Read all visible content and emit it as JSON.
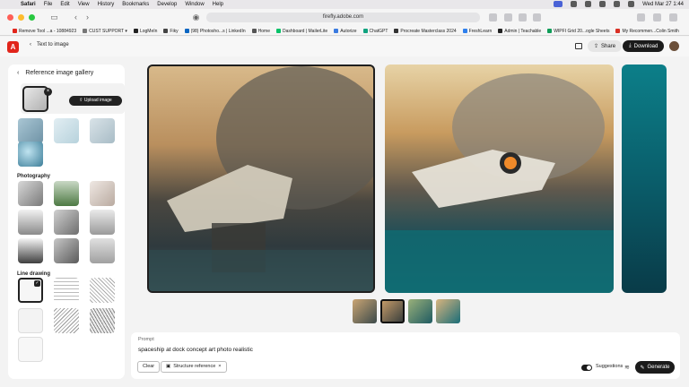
{
  "menubar": {
    "app": "Safari",
    "menus": [
      "File",
      "Edit",
      "View",
      "History",
      "Bookmarks",
      "Develop",
      "Window",
      "Help"
    ],
    "clock": "Wed Mar 27  1:44"
  },
  "browser": {
    "address": "firefly.adobe.com",
    "bookmarks": [
      {
        "label": "Remove Tool ...a - 10884923",
        "color": "#e1251b"
      },
      {
        "label": "CUST SUPPORT ▾",
        "color": "#777777"
      },
      {
        "label": "LogMeIn",
        "color": "#222222"
      },
      {
        "label": "Fiky",
        "color": "#444444"
      },
      {
        "label": "(98) Photosho...s | LinkedIn",
        "color": "#0a66c2"
      },
      {
        "label": "Home",
        "color": "#555555"
      },
      {
        "label": "Dashboard | MailerLite",
        "color": "#09c269"
      },
      {
        "label": "Autorize",
        "color": "#3a7be0"
      },
      {
        "label": "ChatGPT",
        "color": "#10a37f"
      },
      {
        "label": "Procreate Masterclass 2024",
        "color": "#333333"
      },
      {
        "label": "FreshLearn",
        "color": "#2f80ed"
      },
      {
        "label": "Admin | Teachable",
        "color": "#222222"
      },
      {
        "label": "WIPFI Grid 20...ogle Sheets",
        "color": "#0f9d58"
      },
      {
        "label": "My Recommen...Colin Smith",
        "color": "#d93025"
      }
    ]
  },
  "header": {
    "back_label": "Text to image",
    "share_label": "Share",
    "download_label": "Download"
  },
  "gallery": {
    "title": "Reference image gallery",
    "upload_label": "Upload image",
    "sections": [
      {
        "label": "Photography"
      },
      {
        "label": "Line drawing"
      }
    ]
  },
  "prompt": {
    "label": "Prompt",
    "text": "spaceship at dock concept art photo realistic",
    "clear_label": "Clear",
    "structure_label": "Structure reference",
    "suggestions_label": "Suggestions",
    "generate_label": "Generate"
  }
}
